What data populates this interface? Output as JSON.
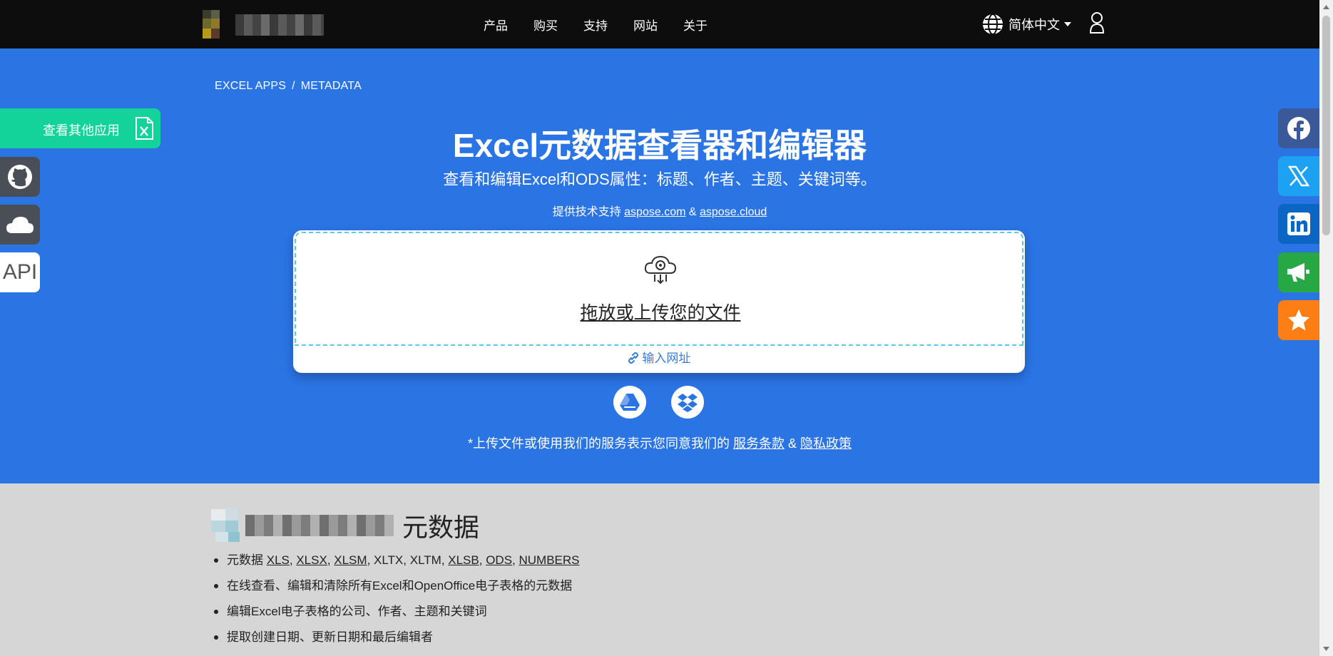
{
  "nav": {
    "links": [
      "产品",
      "购买",
      "支持",
      "网站",
      "关于"
    ],
    "language": "简体中文"
  },
  "hero": {
    "breadcrumb": [
      "EXCEL APPS",
      "METADATA"
    ],
    "breadcrumb_sep": "/",
    "title": "Excel元数据查看器和编辑器",
    "subtitle": "查看和编辑Excel和ODS属性：标题、作者、主题、关键词等。",
    "powered_prefix": "提供技术支持",
    "powered_link1": "aspose.com",
    "powered_amp": "&",
    "powered_link2": "aspose.cloud",
    "drop_text": "拖放或上传您的文件",
    "url_text": "输入网址",
    "terms_prefix": "*上传文件或使用我们的服务表示您同意我们的",
    "terms_link": "服务条款",
    "terms_amp": "&",
    "privacy_link": "隐私政策"
  },
  "left": {
    "other_apps": "查看其他应用",
    "api": "API"
  },
  "section": {
    "title": "元数据",
    "item1_prefix": "元数据",
    "formats": [
      "XLS",
      "XLSX",
      "XLSM",
      "XLTX",
      "XLTM",
      "XLSB",
      "ODS",
      "NUMBERS"
    ],
    "item2": "在线查看、编辑和清除所有Excel和OpenOffice电子表格的元数据",
    "item3": "编辑Excel电子表格的公司、作者、主题和关键词",
    "item4": "提取创建日期、更新日期和最后编辑者"
  },
  "colors": {
    "hero": "#2b74e4",
    "navbar": "#0d0d0d",
    "other_apps": "#13d39a",
    "facebook": "#3b5998",
    "twitter": "#1da1f2",
    "linkedin": "#0a66c2",
    "announce": "#28a745",
    "star": "#fd7e14"
  }
}
